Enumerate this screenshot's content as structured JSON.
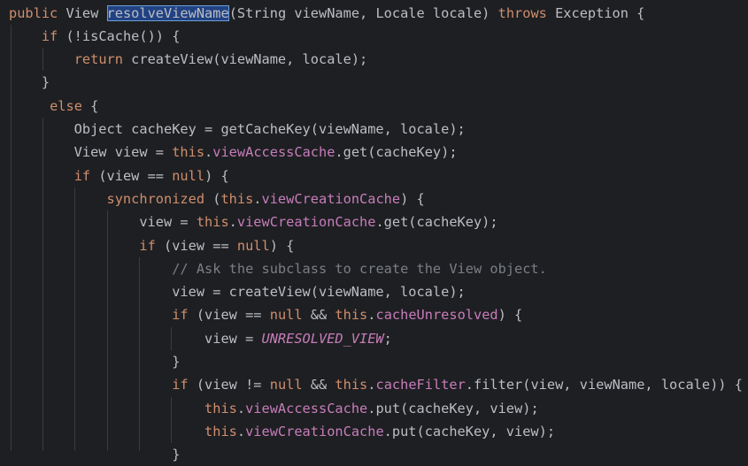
{
  "editor": {
    "language": "Java",
    "selected_token": "resolveViewName",
    "colors": {
      "background": "#1e1f22",
      "default_text": "#bcbec4",
      "keyword": "#cf8e6d",
      "field": "#c77dbb",
      "comment": "#7a7e85",
      "selection": "#214283"
    },
    "lines": [
      [
        {
          "t": "public",
          "c": "kw"
        },
        {
          "t": " View "
        },
        {
          "t": "resolveViewName",
          "c": "hl"
        },
        {
          "t": "(String viewName, Locale locale) "
        },
        {
          "t": "throws",
          "c": "kw"
        },
        {
          "t": " Exception {"
        }
      ],
      [
        {
          "t": "    "
        },
        {
          "t": "if",
          "c": "kw"
        },
        {
          "t": " (!isCache()) {"
        }
      ],
      [
        {
          "t": "        "
        },
        {
          "t": "return",
          "c": "kw"
        },
        {
          "t": " createView(viewName, locale);"
        }
      ],
      [
        {
          "t": "    }"
        }
      ],
      [
        {
          "t": "     "
        },
        {
          "t": "else",
          "c": "kw"
        },
        {
          "t": " {"
        }
      ],
      [
        {
          "t": "        Object cacheKey = getCacheKey(viewName, locale);"
        }
      ],
      [
        {
          "t": "        View view = "
        },
        {
          "t": "this",
          "c": "kw"
        },
        {
          "t": "."
        },
        {
          "t": "viewAccessCache",
          "c": "fld"
        },
        {
          "t": ".get(cacheKey);"
        }
      ],
      [
        {
          "t": "        "
        },
        {
          "t": "if",
          "c": "kw"
        },
        {
          "t": " (view == "
        },
        {
          "t": "null",
          "c": "kw"
        },
        {
          "t": ") {"
        }
      ],
      [
        {
          "t": "            "
        },
        {
          "t": "synchronized",
          "c": "kw"
        },
        {
          "t": " ("
        },
        {
          "t": "this",
          "c": "kw"
        },
        {
          "t": "."
        },
        {
          "t": "viewCreationCache",
          "c": "fld"
        },
        {
          "t": ") {"
        }
      ],
      [
        {
          "t": "                view = "
        },
        {
          "t": "this",
          "c": "kw"
        },
        {
          "t": "."
        },
        {
          "t": "viewCreationCache",
          "c": "fld"
        },
        {
          "t": ".get(cacheKey);"
        }
      ],
      [
        {
          "t": "                "
        },
        {
          "t": "if",
          "c": "kw"
        },
        {
          "t": " (view == "
        },
        {
          "t": "null",
          "c": "kw"
        },
        {
          "t": ") {"
        }
      ],
      [
        {
          "t": "                    "
        },
        {
          "t": "// Ask the subclass to create the View object.",
          "c": "cmt"
        }
      ],
      [
        {
          "t": "                    view = createView(viewName, locale);"
        }
      ],
      [
        {
          "t": "                    "
        },
        {
          "t": "if",
          "c": "kw"
        },
        {
          "t": " (view == "
        },
        {
          "t": "null",
          "c": "kw"
        },
        {
          "t": " && "
        },
        {
          "t": "this",
          "c": "kw"
        },
        {
          "t": "."
        },
        {
          "t": "cacheUnresolved",
          "c": "fld"
        },
        {
          "t": ") {"
        }
      ],
      [
        {
          "t": "                        view = "
        },
        {
          "t": "UNRESOLVED_VIEW",
          "c": "const"
        },
        {
          "t": ";"
        }
      ],
      [
        {
          "t": "                    }"
        }
      ],
      [
        {
          "t": "                    "
        },
        {
          "t": "if",
          "c": "kw"
        },
        {
          "t": " (view != "
        },
        {
          "t": "null",
          "c": "kw"
        },
        {
          "t": " && "
        },
        {
          "t": "this",
          "c": "kw"
        },
        {
          "t": "."
        },
        {
          "t": "cacheFilter",
          "c": "fld"
        },
        {
          "t": ".filter(view, viewName, locale)) {"
        }
      ],
      [
        {
          "t": "                        "
        },
        {
          "t": "this",
          "c": "kw"
        },
        {
          "t": "."
        },
        {
          "t": "viewAccessCache",
          "c": "fld"
        },
        {
          "t": ".put(cacheKey, view);"
        }
      ],
      [
        {
          "t": "                        "
        },
        {
          "t": "this",
          "c": "kw"
        },
        {
          "t": "."
        },
        {
          "t": "viewCreationCache",
          "c": "fld"
        },
        {
          "t": ".put(cacheKey, view);"
        }
      ],
      [
        {
          "t": "                    }"
        }
      ]
    ]
  }
}
